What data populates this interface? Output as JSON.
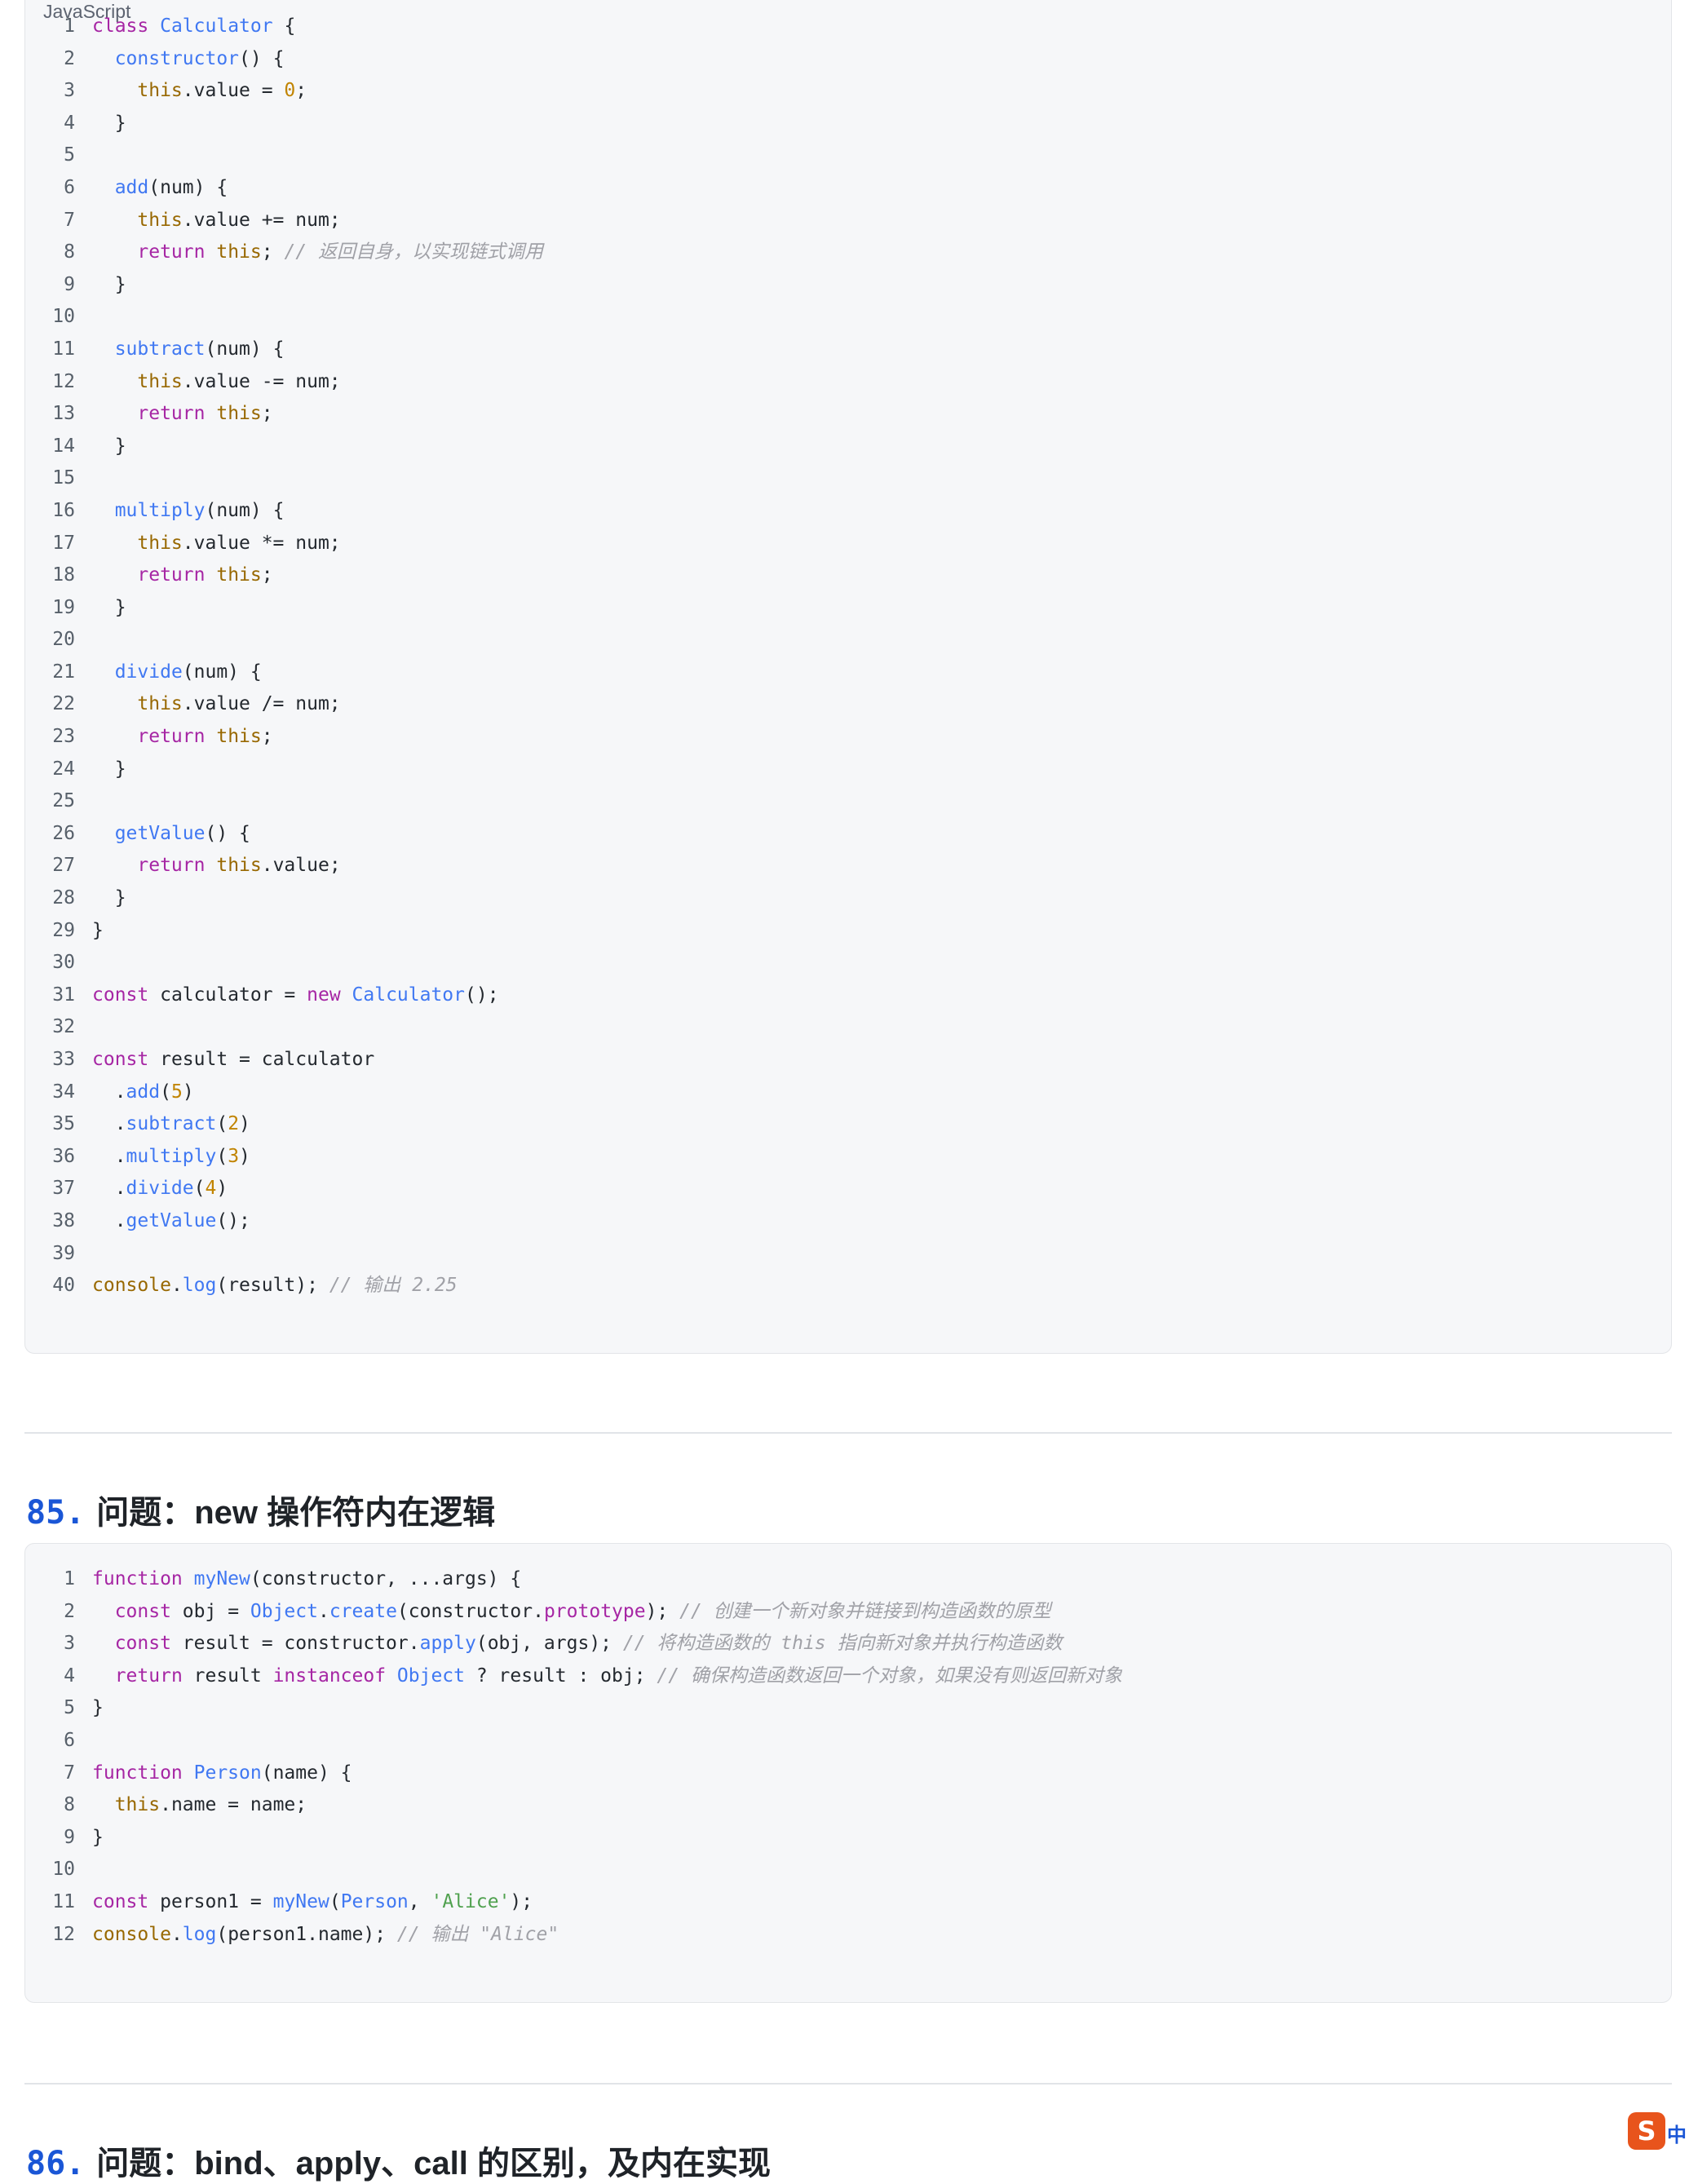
{
  "block1": {
    "language": "JavaScript",
    "lines": [
      [
        {
          "t": "class",
          "c": "kw"
        },
        {
          "t": " "
        },
        {
          "t": "Calculator",
          "c": "fn"
        },
        {
          "t": " {"
        }
      ],
      [
        {
          "t": "  "
        },
        {
          "t": "constructor",
          "c": "fn"
        },
        {
          "t": "() {"
        }
      ],
      [
        {
          "t": "    "
        },
        {
          "t": "this",
          "c": "th"
        },
        {
          "t": ".value = "
        },
        {
          "t": "0",
          "c": "num"
        },
        {
          "t": ";"
        }
      ],
      [
        {
          "t": "  }"
        }
      ],
      [
        {
          "t": ""
        }
      ],
      [
        {
          "t": "  "
        },
        {
          "t": "add",
          "c": "fn"
        },
        {
          "t": "(num) {"
        }
      ],
      [
        {
          "t": "    "
        },
        {
          "t": "this",
          "c": "th"
        },
        {
          "t": ".value += num;"
        }
      ],
      [
        {
          "t": "    "
        },
        {
          "t": "return",
          "c": "kw"
        },
        {
          "t": " "
        },
        {
          "t": "this",
          "c": "th"
        },
        {
          "t": "; "
        },
        {
          "t": "// 返回自身，以实现链式调用",
          "c": "cm"
        }
      ],
      [
        {
          "t": "  }"
        }
      ],
      [
        {
          "t": ""
        }
      ],
      [
        {
          "t": "  "
        },
        {
          "t": "subtract",
          "c": "fn"
        },
        {
          "t": "(num) {"
        }
      ],
      [
        {
          "t": "    "
        },
        {
          "t": "this",
          "c": "th"
        },
        {
          "t": ".value -= num;"
        }
      ],
      [
        {
          "t": "    "
        },
        {
          "t": "return",
          "c": "kw"
        },
        {
          "t": " "
        },
        {
          "t": "this",
          "c": "th"
        },
        {
          "t": ";"
        }
      ],
      [
        {
          "t": "  }"
        }
      ],
      [
        {
          "t": ""
        }
      ],
      [
        {
          "t": "  "
        },
        {
          "t": "multiply",
          "c": "fn"
        },
        {
          "t": "(num) {"
        }
      ],
      [
        {
          "t": "    "
        },
        {
          "t": "this",
          "c": "th"
        },
        {
          "t": ".value *= num;"
        }
      ],
      [
        {
          "t": "    "
        },
        {
          "t": "return",
          "c": "kw"
        },
        {
          "t": " "
        },
        {
          "t": "this",
          "c": "th"
        },
        {
          "t": ";"
        }
      ],
      [
        {
          "t": "  }"
        }
      ],
      [
        {
          "t": ""
        }
      ],
      [
        {
          "t": "  "
        },
        {
          "t": "divide",
          "c": "fn"
        },
        {
          "t": "(num) {"
        }
      ],
      [
        {
          "t": "    "
        },
        {
          "t": "this",
          "c": "th"
        },
        {
          "t": ".value /= num;"
        }
      ],
      [
        {
          "t": "    "
        },
        {
          "t": "return",
          "c": "kw"
        },
        {
          "t": " "
        },
        {
          "t": "this",
          "c": "th"
        },
        {
          "t": ";"
        }
      ],
      [
        {
          "t": "  }"
        }
      ],
      [
        {
          "t": ""
        }
      ],
      [
        {
          "t": "  "
        },
        {
          "t": "getValue",
          "c": "fn"
        },
        {
          "t": "() {"
        }
      ],
      [
        {
          "t": "    "
        },
        {
          "t": "return",
          "c": "kw"
        },
        {
          "t": " "
        },
        {
          "t": "this",
          "c": "th"
        },
        {
          "t": ".value;"
        }
      ],
      [
        {
          "t": "  }"
        }
      ],
      [
        {
          "t": "}"
        }
      ],
      [
        {
          "t": ""
        }
      ],
      [
        {
          "t": "const",
          "c": "kw"
        },
        {
          "t": " calculator = "
        },
        {
          "t": "new",
          "c": "kw"
        },
        {
          "t": " "
        },
        {
          "t": "Calculator",
          "c": "fn"
        },
        {
          "t": "();"
        }
      ],
      [
        {
          "t": ""
        }
      ],
      [
        {
          "t": "const",
          "c": "kw"
        },
        {
          "t": " result = calculator"
        }
      ],
      [
        {
          "t": "  ."
        },
        {
          "t": "add",
          "c": "fn"
        },
        {
          "t": "("
        },
        {
          "t": "5",
          "c": "num"
        },
        {
          "t": ")"
        }
      ],
      [
        {
          "t": "  ."
        },
        {
          "t": "subtract",
          "c": "fn"
        },
        {
          "t": "("
        },
        {
          "t": "2",
          "c": "num"
        },
        {
          "t": ")"
        }
      ],
      [
        {
          "t": "  ."
        },
        {
          "t": "multiply",
          "c": "fn"
        },
        {
          "t": "("
        },
        {
          "t": "3",
          "c": "num"
        },
        {
          "t": ")"
        }
      ],
      [
        {
          "t": "  ."
        },
        {
          "t": "divide",
          "c": "fn"
        },
        {
          "t": "("
        },
        {
          "t": "4",
          "c": "num"
        },
        {
          "t": ")"
        }
      ],
      [
        {
          "t": "  ."
        },
        {
          "t": "getValue",
          "c": "fn"
        },
        {
          "t": "();"
        }
      ],
      [
        {
          "t": ""
        }
      ],
      [
        {
          "t": "console",
          "c": "th"
        },
        {
          "t": "."
        },
        {
          "t": "log",
          "c": "fn"
        },
        {
          "t": "(result); "
        },
        {
          "t": "// 输出 2.25",
          "c": "cm"
        }
      ]
    ]
  },
  "section85": {
    "number": "85.",
    "title": "问题：new 操作符内在逻辑"
  },
  "block2": {
    "lines": [
      [
        {
          "t": "function",
          "c": "kw"
        },
        {
          "t": " "
        },
        {
          "t": "myNew",
          "c": "fn"
        },
        {
          "t": "(constructor, ...args) {"
        }
      ],
      [
        {
          "t": "  "
        },
        {
          "t": "const",
          "c": "kw"
        },
        {
          "t": " obj = "
        },
        {
          "t": "Object",
          "c": "fn"
        },
        {
          "t": "."
        },
        {
          "t": "create",
          "c": "fn"
        },
        {
          "t": "(constructor."
        },
        {
          "t": "prototype",
          "c": "kw"
        },
        {
          "t": "); "
        },
        {
          "t": "// 创建一个新对象并链接到构造函数的原型",
          "c": "cm"
        }
      ],
      [
        {
          "t": "  "
        },
        {
          "t": "const",
          "c": "kw"
        },
        {
          "t": " result = constructor."
        },
        {
          "t": "apply",
          "c": "fn"
        },
        {
          "t": "(obj, args); "
        },
        {
          "t": "// 将构造函数的 this 指向新对象并执行构造函数",
          "c": "cm"
        }
      ],
      [
        {
          "t": "  "
        },
        {
          "t": "return",
          "c": "kw"
        },
        {
          "t": " result "
        },
        {
          "t": "instanceof",
          "c": "kw"
        },
        {
          "t": " "
        },
        {
          "t": "Object",
          "c": "fn"
        },
        {
          "t": " ? result : obj; "
        },
        {
          "t": "// 确保构造函数返回一个对象，如果没有则返回新对象",
          "c": "cm"
        }
      ],
      [
        {
          "t": "}"
        }
      ],
      [
        {
          "t": ""
        }
      ],
      [
        {
          "t": "function",
          "c": "kw"
        },
        {
          "t": " "
        },
        {
          "t": "Person",
          "c": "fn"
        },
        {
          "t": "(name) {"
        }
      ],
      [
        {
          "t": "  "
        },
        {
          "t": "this",
          "c": "th"
        },
        {
          "t": ".name = name;"
        }
      ],
      [
        {
          "t": "}"
        }
      ],
      [
        {
          "t": ""
        }
      ],
      [
        {
          "t": "const",
          "c": "kw"
        },
        {
          "t": " person1 = "
        },
        {
          "t": "myNew",
          "c": "fn"
        },
        {
          "t": "("
        },
        {
          "t": "Person",
          "c": "fn"
        },
        {
          "t": ", "
        },
        {
          "t": "'Alice'",
          "c": "str"
        },
        {
          "t": ");"
        }
      ],
      [
        {
          "t": "console",
          "c": "th"
        },
        {
          "t": "."
        },
        {
          "t": "log",
          "c": "fn"
        },
        {
          "t": "(person1.name); "
        },
        {
          "t": "// 输出 \"Alice\"",
          "c": "cm"
        }
      ]
    ]
  },
  "section86": {
    "number": "86.",
    "title": "问题：bind、apply、call 的区别，及内在实现"
  },
  "ime": {
    "icon_text": "S",
    "label": "中"
  }
}
